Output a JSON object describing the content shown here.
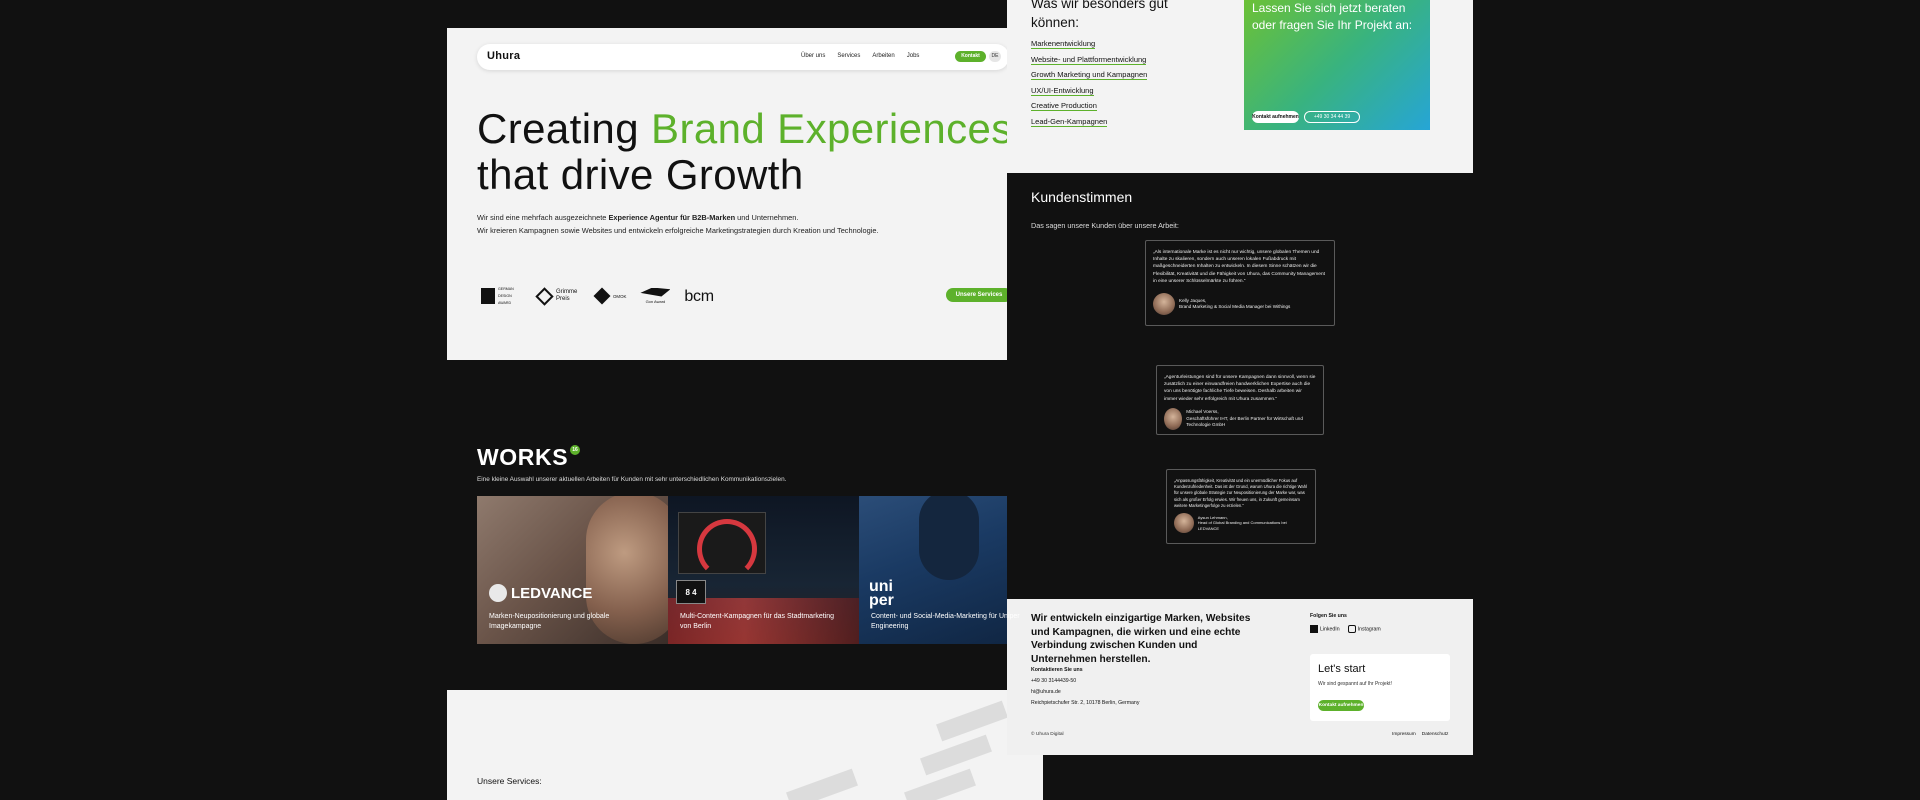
{
  "colors": {
    "accent": "#5db12b",
    "dark": "#111111",
    "light": "#f3f3f3",
    "gradient_from": "#6cc136",
    "gradient_to": "#26a5d6"
  },
  "nav": {
    "logo": "Uhura",
    "links": [
      "Über uns",
      "Services",
      "Arbeiten",
      "Jobs"
    ],
    "cta": "Kontakt",
    "lang": "DE"
  },
  "hero": {
    "headline_1": "Creating ",
    "headline_accent": "Brand Experiences",
    "headline_2": "that drive Growth",
    "intro_a": "Wir sind eine mehrfach ausgezeichnete ",
    "intro_bold": "Experience Agentur für B2B-Marken",
    "intro_b": " und Unternehmen.",
    "intro_line2": "Wir kreieren Kampagnen sowie Websites und entwickeln erfolgreiche Marketingstrategien durch Kreation und Technologie.",
    "awards": [
      {
        "icon": "award-shield-icon",
        "label": "GERMAN DESIGN AWARD"
      },
      {
        "icon": "award-diamond-icon",
        "label": "Grimme Preis"
      },
      {
        "icon": "award-star-icon",
        "label": "OMOK"
      },
      {
        "icon": "award-lion-icon",
        "label": "Gon Award"
      },
      {
        "icon": "bcm-logo-icon",
        "label": "bcm"
      }
    ],
    "cta": "Unsere Services"
  },
  "works": {
    "title": "WORKS",
    "count": "16",
    "subtitle": "Eine kleine Auswahl unserer aktuellen Arbeiten für Kunden mit sehr unterschiedlichen Kommunikationszielen.",
    "cards": [
      {
        "brand": "LEDVANCE",
        "caption": "Marken-Neupositionierung und globale Imagekampagne"
      },
      {
        "brand": "8 4",
        "caption": "Multi-Content-Kampagnen für das Stadtmarketing von Berlin"
      },
      {
        "brand": "uni per",
        "caption": "Content- und Social-Media-Marketing für Uniper Engineering"
      }
    ]
  },
  "services": {
    "title": "Unsere Services:"
  },
  "right_top": {
    "title_1": "Was wir besonders gut",
    "title_2": "können:",
    "items": [
      "Markenentwicklung",
      "Website- und Plattformentwicklung",
      "Growth Marketing und Kampagnen",
      "UX/UI-Entwicklung",
      "Creative Production",
      "Lead-Gen-Kampagnen"
    ],
    "card_text_1": "Lassen Sie sich jetzt beraten",
    "card_text_2": "oder fragen Sie Ihr Projekt an:",
    "card_btn_1": "Kontakt aufnehmen",
    "card_btn_2": "+49 30 34 44 39"
  },
  "testimonials": {
    "title": "Kundenstimmen",
    "subtitle": "Das sagen unsere Kunden über unsere Arbeit:",
    "items": [
      {
        "quote": "„Als internationale Marke ist es nicht nur wichtig, unsere globalen Themen und Inhalte zu skalieren, sondern auch unseren lokalen Fußabdruck mit maßgeschneiderten Inhalten zu entwickeln. In diesem Sinne schätzen wir die Flexibilität, Kreativität und die Fähigkeit von Uhura, das Community Management in eine unserer Schlüsselmärkte zu führen.“",
        "name": "Kelly Jaques,",
        "role": "Brand Marketing & Social Media Manager bei Withings"
      },
      {
        "quote": "„Agenturleistungen sind für unsere Kampagnen dann sinnvoll, wenn sie zusätzlich zu einer einwandfreien handwerklichen Expertise auch die von uns benötigte fachliche Tiefe beweisen. Deshalb arbeiten wir immer wieder sehr erfolgreich mit Uhura zusammen.“",
        "name": "Michael Voerss,",
        "role": "Geschäftsführer IHT, der Berlin Partner für Wirtschaft und Technologie GmbH"
      },
      {
        "quote": "„Anpassungsfähigkeit, Kreativität und ein unermüdlicher Fokus auf Kundenzufriedenheit. Das ist der Grund, warum Uhura die richtige Wahl für unsere globale Strategie zur Neupositionierung der Marke war, was sich als großer Erfolg erwies. Wir freuen uns, in Zukunft gemeinsam weitere Marketingerfolge zu erzielen.“",
        "name": "Aysun Lehmann,",
        "role": "Head of Global Branding and Communications bei LEDVANCE"
      }
    ]
  },
  "footer": {
    "lead": "Wir entwickeln einzigartige Marken, Websites und Kampagnen, die wirken und eine echte Verbindung zwischen Kunden und Unternehmen herstellen.",
    "follow": "Folgen Sie uns",
    "social": [
      "LinkedIn",
      "Instagram"
    ],
    "contact_title": "Kontaktieren Sie uns",
    "phone": "+49 30 3144439-50",
    "email": "hi@uhura.de",
    "address": "Reichpietschufer Str. 2, 10178 Berlin, Germany",
    "box_title": "Let's start",
    "box_sub": "Wir sind gespannt auf Ihr Projekt!",
    "box_btn": "Kontakt aufnehmen",
    "copyright": "© Uhura Digital",
    "legal": [
      "Impressum",
      "Datenschutz"
    ]
  }
}
